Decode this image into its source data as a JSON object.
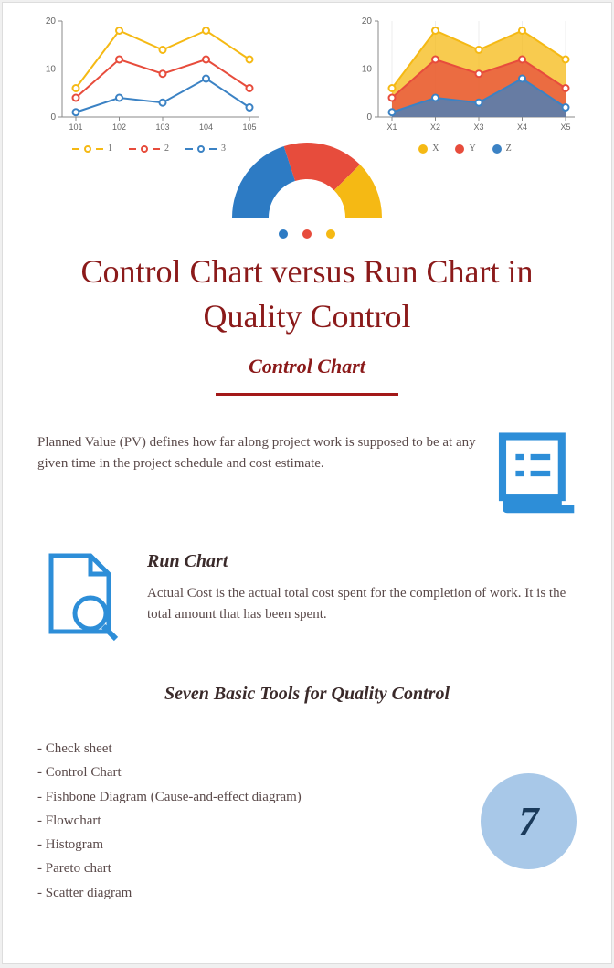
{
  "chart_data": [
    {
      "type": "line",
      "categories": [
        "101",
        "102",
        "103",
        "104",
        "105"
      ],
      "series": [
        {
          "name": "1",
          "values": [
            6,
            18,
            14,
            18,
            12
          ],
          "color": "#f5b914"
        },
        {
          "name": "2",
          "values": [
            4,
            12,
            9,
            12,
            6
          ],
          "color": "#e74c3c"
        },
        {
          "name": "3",
          "values": [
            1,
            4,
            3,
            8,
            2
          ],
          "color": "#3b82c4"
        }
      ],
      "ylim": [
        0,
        20
      ],
      "yticks": [
        0,
        10,
        20
      ]
    },
    {
      "type": "area",
      "categories": [
        "X1",
        "X2",
        "X3",
        "X4",
        "X5"
      ],
      "series": [
        {
          "name": "X",
          "values": [
            6,
            18,
            14,
            18,
            12
          ],
          "color": "#f5b914"
        },
        {
          "name": "Y",
          "values": [
            4,
            12,
            9,
            12,
            6
          ],
          "color": "#e74c3c"
        },
        {
          "name": "Z",
          "values": [
            1,
            4,
            3,
            8,
            2
          ],
          "color": "#3b82c4"
        }
      ],
      "ylim": [
        0,
        20
      ],
      "yticks": [
        0,
        10,
        20
      ]
    },
    {
      "type": "pie",
      "gauge": true,
      "slices": [
        {
          "name": "blue",
          "value": 40,
          "color": "#2d7bc4"
        },
        {
          "name": "red",
          "value": 35,
          "color": "#e74c3c"
        },
        {
          "name": "yellow",
          "value": 25,
          "color": "#f5b914"
        }
      ]
    }
  ],
  "dots": [
    "#2d7bc4",
    "#e74c3c",
    "#f5b914"
  ],
  "title": "Control Chart versus Run Chart in Quality Control",
  "section1": {
    "heading": "Control Chart",
    "text": "Planned Value (PV) defines how far along project work is supposed to be at any given time in the project schedule and cost estimate."
  },
  "section2": {
    "heading": "Run Chart",
    "text": "Actual Cost is the actual total cost spent for the completion of work. It is the total amount that has been spent."
  },
  "tools": {
    "heading": "Seven Basic Tools for Quality Control",
    "items": [
      "Check sheet",
      "Control Chart",
      "Fishbone Diagram (Cause-and-effect diagram)",
      "Flowchart",
      "Histogram",
      "Pareto chart",
      "Scatter diagram"
    ],
    "count": "7"
  }
}
